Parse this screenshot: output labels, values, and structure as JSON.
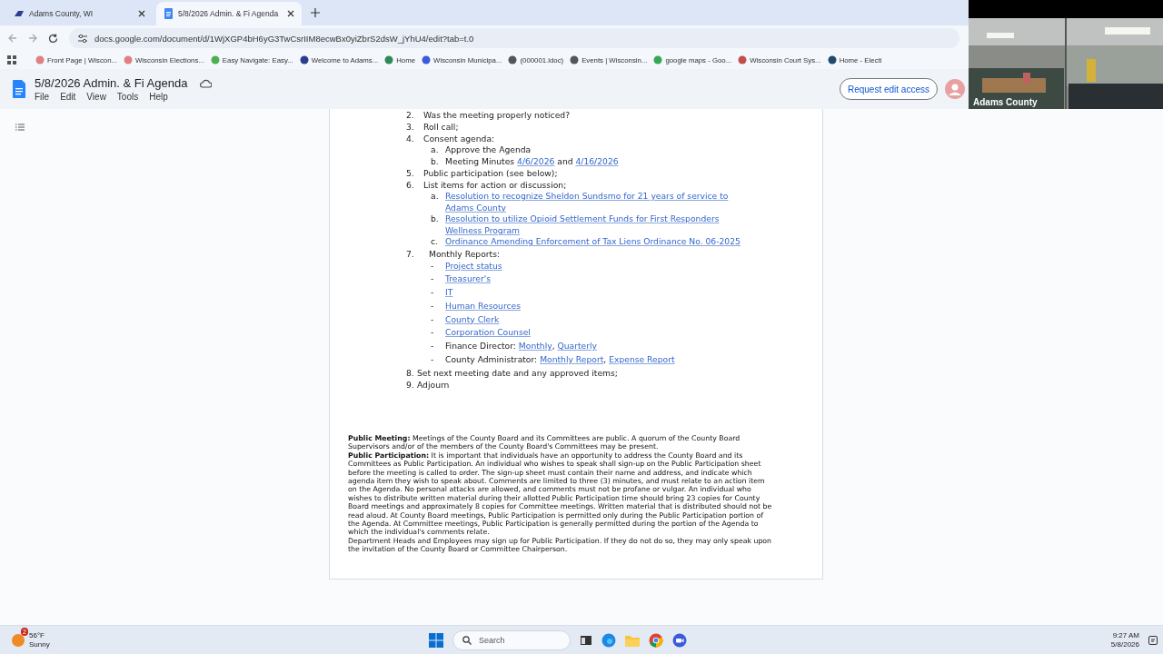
{
  "browser_tabs": [
    {
      "title": "Adams County, WI",
      "kind": "site",
      "selected": false
    },
    {
      "title": "5/8/2026 Admin. & Fi Agenda",
      "kind": "doc",
      "selected": true
    }
  ],
  "address_bar": {
    "url": "docs.google.com/document/d/1WjXGP4bH6yG3TwCsrIIM8ecwBx0yiZbrS2dsW_jYhU4/edit?tab=t.0"
  },
  "bookmarks": [
    "Front Page | Wiscon...",
    "Wisconsin Elections...",
    "Easy Navigate: Easy...",
    "Welcome to Adams...",
    "Home",
    "Wisconsin Municipa...",
    "(000001.ldoc)",
    "Events | Wisconsin...",
    "google maps - Goo...",
    "Wisconsin Court Sys...",
    "Home - Electi"
  ],
  "document": {
    "title": "5/8/2026 Admin. & Fi Agenda",
    "menu": [
      "File",
      "Edit",
      "View",
      "Tools",
      "Help"
    ],
    "request_button": "Request edit access"
  },
  "video": {
    "caption": "Adams County"
  },
  "agenda": [
    {
      "kind": "numbered",
      "number": "2.",
      "segments": [
        {
          "kind": "text",
          "text": "Was the meeting properly noticed?"
        }
      ]
    },
    {
      "kind": "numbered",
      "number": "3.",
      "segments": [
        {
          "kind": "text",
          "text": "Roll call;"
        }
      ]
    },
    {
      "kind": "numbered",
      "number": "4.",
      "segments": [
        {
          "kind": "text",
          "text": "Consent agenda:"
        }
      ],
      "children": [
        {
          "marker": "a.",
          "segments": [
            {
              "kind": "text",
              "text": "Approve the Agenda"
            }
          ]
        },
        {
          "marker": "b.",
          "segments": [
            {
              "kind": "text",
              "text": "Meeting Minutes "
            },
            {
              "kind": "link",
              "text": "4/6/2026"
            },
            {
              "kind": "text",
              "text": " and "
            },
            {
              "kind": "link",
              "text": "4/16/2026"
            }
          ]
        }
      ]
    },
    {
      "kind": "numbered",
      "number": "5.",
      "segments": [
        {
          "kind": "text",
          "text": "Public participation (see below);"
        }
      ]
    },
    {
      "kind": "numbered",
      "number": "6.",
      "segments": [
        {
          "kind": "text",
          "text": "List items for action or discussion;"
        }
      ],
      "children": [
        {
          "marker": "a.",
          "segments": [
            {
              "kind": "link",
              "text": "Resolution to recognize Sheldon Sundsmo for 21 years of service to Adams County"
            }
          ]
        },
        {
          "marker": "b.",
          "segments": [
            {
              "kind": "link",
              "text": "Resolution to utilize Opioid Settlement Funds for First Responders Wellness Program"
            }
          ]
        },
        {
          "marker": "c.",
          "segments": [
            {
              "kind": "link",
              "text": "Ordinance Amending Enforcement of Tax Liens Ordinance No. 06-2025"
            }
          ]
        }
      ]
    },
    {
      "kind": "wide",
      "number": "7.",
      "segments": [
        {
          "kind": "text",
          "text": "Monthly Reports:"
        }
      ],
      "children": [
        {
          "marker": "-",
          "segments": [
            {
              "kind": "link",
              "text": "Project status"
            }
          ]
        },
        {
          "marker": "-",
          "segments": [
            {
              "kind": "link",
              "text": "Treasurer's"
            }
          ]
        },
        {
          "marker": "-",
          "segments": [
            {
              "kind": "link",
              "text": "IT"
            }
          ]
        },
        {
          "marker": "-",
          "segments": [
            {
              "kind": "link",
              "text": "Human Resources"
            }
          ]
        },
        {
          "marker": "-",
          "segments": [
            {
              "kind": "link",
              "text": "County Clerk"
            }
          ]
        },
        {
          "marker": "-",
          "segments": [
            {
              "kind": "link",
              "text": "Corporation Counsel"
            }
          ]
        },
        {
          "marker": "-",
          "segments": [
            {
              "kind": "text",
              "text": "Finance Director: "
            },
            {
              "kind": "link",
              "text": "Monthly"
            },
            {
              "kind": "text",
              "text": ", "
            },
            {
              "kind": "link",
              "text": "Quarterly"
            }
          ]
        },
        {
          "marker": "-",
          "segments": [
            {
              "kind": "text",
              "text": "County Administrator: "
            },
            {
              "kind": "link",
              "text": "Monthly Report"
            },
            {
              "kind": "text",
              "text": ", "
            },
            {
              "kind": "link",
              "text": "Expense Report"
            }
          ]
        }
      ]
    },
    {
      "kind": "inline",
      "number": "8.",
      "segments": [
        {
          "kind": "text",
          "text": "Set next meeting date and any approved items;"
        }
      ]
    },
    {
      "kind": "inline",
      "number": "9.",
      "segments": [
        {
          "kind": "text",
          "text": "Adjourn"
        }
      ]
    }
  ],
  "notice": [
    "**Public Meeting:** Meetings of the County Board and its Committees are public. A quorum of the County Board Supervisors and/or of the members of the County Board's Committees may be present.",
    "**Public Participation:** It is important that individuals have an opportunity to address the County Board and its Committees as Public Participation. An individual who wishes to speak shall sign-up on the Public Participation sheet before the meeting is called to order. The sign-up sheet must contain their name and address, and indicate which agenda item they wish to speak about. Comments are limited to three (3) minutes, and must relate to an action item on the Agenda. No personal attacks are allowed, and comments must not be profane or vulgar. An individual who wishes to distribute written material during their allotted Public Participation time should bring 23 copies for County Board meetings and approximately 8 copies for Committee meetings. Written material that is distributed should not be read aloud. At County Board meetings, Public Participation is permitted only during the Public Participation portion of the Agenda. At Committee meetings, Public Participation is generally permitted during the portion of the Agenda to which the individual's comments relate.",
    "Department Heads and Employees may sign up for Public Participation. If they do not do so, they may only speak upon the invitation of the County Board or Committee Chairperson."
  ],
  "taskbar": {
    "weather_badge": "2",
    "temperature": "56°F",
    "condition": "Sunny",
    "search_placeholder": "Search",
    "time": "9:27 AM",
    "date": "5/8/2026"
  }
}
